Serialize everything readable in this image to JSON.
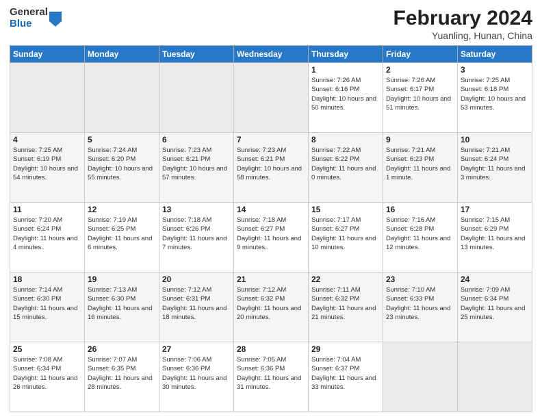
{
  "header": {
    "logo": {
      "general": "General",
      "blue": "Blue"
    },
    "title": "February 2024",
    "location": "Yuanling, Hunan, China"
  },
  "calendar": {
    "days_of_week": [
      "Sunday",
      "Monday",
      "Tuesday",
      "Wednesday",
      "Thursday",
      "Friday",
      "Saturday"
    ],
    "weeks": [
      [
        {
          "day": "",
          "info": ""
        },
        {
          "day": "",
          "info": ""
        },
        {
          "day": "",
          "info": ""
        },
        {
          "day": "",
          "info": ""
        },
        {
          "day": "1",
          "info": "Sunrise: 7:26 AM\nSunset: 6:16 PM\nDaylight: 10 hours and 50 minutes."
        },
        {
          "day": "2",
          "info": "Sunrise: 7:26 AM\nSunset: 6:17 PM\nDaylight: 10 hours and 51 minutes."
        },
        {
          "day": "3",
          "info": "Sunrise: 7:25 AM\nSunset: 6:18 PM\nDaylight: 10 hours and 53 minutes."
        }
      ],
      [
        {
          "day": "4",
          "info": "Sunrise: 7:25 AM\nSunset: 6:19 PM\nDaylight: 10 hours and 54 minutes."
        },
        {
          "day": "5",
          "info": "Sunrise: 7:24 AM\nSunset: 6:20 PM\nDaylight: 10 hours and 55 minutes."
        },
        {
          "day": "6",
          "info": "Sunrise: 7:23 AM\nSunset: 6:21 PM\nDaylight: 10 hours and 57 minutes."
        },
        {
          "day": "7",
          "info": "Sunrise: 7:23 AM\nSunset: 6:21 PM\nDaylight: 10 hours and 58 minutes."
        },
        {
          "day": "8",
          "info": "Sunrise: 7:22 AM\nSunset: 6:22 PM\nDaylight: 11 hours and 0 minutes."
        },
        {
          "day": "9",
          "info": "Sunrise: 7:21 AM\nSunset: 6:23 PM\nDaylight: 11 hours and 1 minute."
        },
        {
          "day": "10",
          "info": "Sunrise: 7:21 AM\nSunset: 6:24 PM\nDaylight: 11 hours and 3 minutes."
        }
      ],
      [
        {
          "day": "11",
          "info": "Sunrise: 7:20 AM\nSunset: 6:24 PM\nDaylight: 11 hours and 4 minutes."
        },
        {
          "day": "12",
          "info": "Sunrise: 7:19 AM\nSunset: 6:25 PM\nDaylight: 11 hours and 6 minutes."
        },
        {
          "day": "13",
          "info": "Sunrise: 7:18 AM\nSunset: 6:26 PM\nDaylight: 11 hours and 7 minutes."
        },
        {
          "day": "14",
          "info": "Sunrise: 7:18 AM\nSunset: 6:27 PM\nDaylight: 11 hours and 9 minutes."
        },
        {
          "day": "15",
          "info": "Sunrise: 7:17 AM\nSunset: 6:27 PM\nDaylight: 11 hours and 10 minutes."
        },
        {
          "day": "16",
          "info": "Sunrise: 7:16 AM\nSunset: 6:28 PM\nDaylight: 11 hours and 12 minutes."
        },
        {
          "day": "17",
          "info": "Sunrise: 7:15 AM\nSunset: 6:29 PM\nDaylight: 11 hours and 13 minutes."
        }
      ],
      [
        {
          "day": "18",
          "info": "Sunrise: 7:14 AM\nSunset: 6:30 PM\nDaylight: 11 hours and 15 minutes."
        },
        {
          "day": "19",
          "info": "Sunrise: 7:13 AM\nSunset: 6:30 PM\nDaylight: 11 hours and 16 minutes."
        },
        {
          "day": "20",
          "info": "Sunrise: 7:12 AM\nSunset: 6:31 PM\nDaylight: 11 hours and 18 minutes."
        },
        {
          "day": "21",
          "info": "Sunrise: 7:12 AM\nSunset: 6:32 PM\nDaylight: 11 hours and 20 minutes."
        },
        {
          "day": "22",
          "info": "Sunrise: 7:11 AM\nSunset: 6:32 PM\nDaylight: 11 hours and 21 minutes."
        },
        {
          "day": "23",
          "info": "Sunrise: 7:10 AM\nSunset: 6:33 PM\nDaylight: 11 hours and 23 minutes."
        },
        {
          "day": "24",
          "info": "Sunrise: 7:09 AM\nSunset: 6:34 PM\nDaylight: 11 hours and 25 minutes."
        }
      ],
      [
        {
          "day": "25",
          "info": "Sunrise: 7:08 AM\nSunset: 6:34 PM\nDaylight: 11 hours and 26 minutes."
        },
        {
          "day": "26",
          "info": "Sunrise: 7:07 AM\nSunset: 6:35 PM\nDaylight: 11 hours and 28 minutes."
        },
        {
          "day": "27",
          "info": "Sunrise: 7:06 AM\nSunset: 6:36 PM\nDaylight: 11 hours and 30 minutes."
        },
        {
          "day": "28",
          "info": "Sunrise: 7:05 AM\nSunset: 6:36 PM\nDaylight: 11 hours and 31 minutes."
        },
        {
          "day": "29",
          "info": "Sunrise: 7:04 AM\nSunset: 6:37 PM\nDaylight: 11 hours and 33 minutes."
        },
        {
          "day": "",
          "info": ""
        },
        {
          "day": "",
          "info": ""
        }
      ]
    ]
  }
}
